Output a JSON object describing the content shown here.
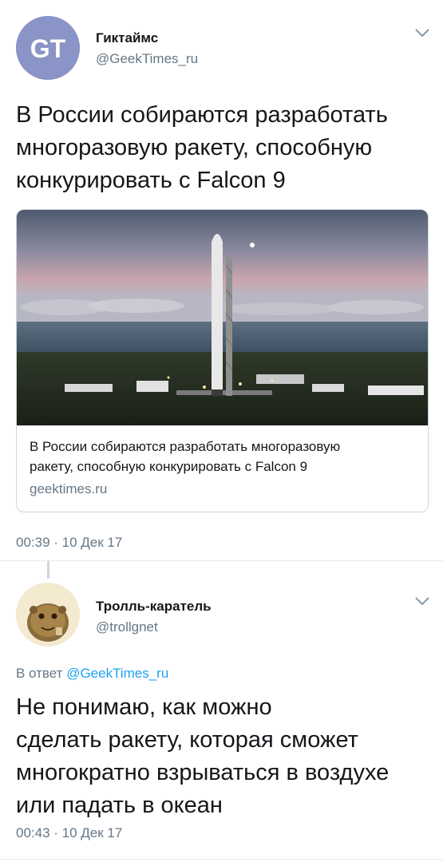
{
  "tweet1": {
    "avatar_text": "GT",
    "avatar_color": "#8a94c6",
    "name": "Гиктаймс",
    "handle": "@GeekTimes_ru",
    "text_lines": [
      "В России собираются разработать",
      "многоразовую ракету, способную",
      "конкурировать с Falcon 9"
    ],
    "card": {
      "title_lines": [
        "В России собираются разработать многоразовую",
        "ракету, способную конкурировать с Falcon 9"
      ],
      "domain": "geektimes.ru"
    },
    "timestamp": "00:39 · 10 Дек 17"
  },
  "tweet2": {
    "name": "Тролль-каратель",
    "handle": "@trollgnet",
    "reply_prefix": "В ответ",
    "reply_to": "@GeekTimes_ru",
    "text_lines": [
      "Не понимаю, как можно",
      "сделать ракету, которая сможет",
      "многократно взрываться в воздухе",
      "или падать в океан"
    ],
    "timestamp": "00:43 · 10 Дек 17"
  },
  "colors": {
    "link": "#1da1f2",
    "secondary": "#657786",
    "text": "#14171a"
  }
}
